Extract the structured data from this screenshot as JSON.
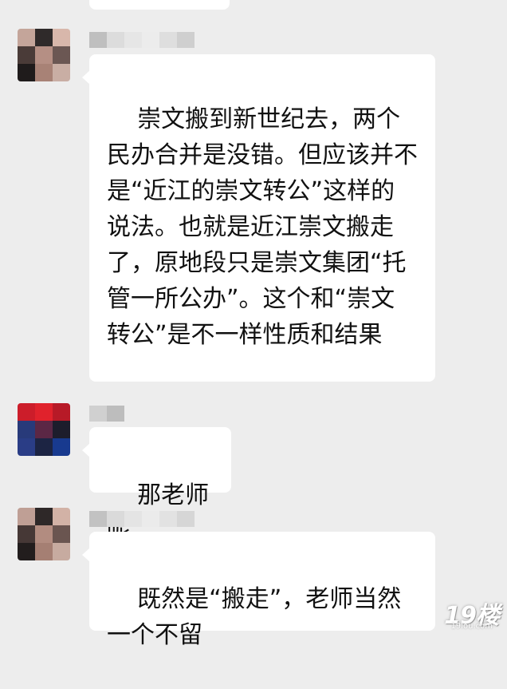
{
  "chat": {
    "background_color": "#ededed",
    "bubble_color": "#ffffff",
    "messages": [
      {
        "text": "崇文搬到新世纪去，两个民办合并是没错。但应该并不是“近江的崇文转公”这样的说法。也就是近江崇文搬走了，原地段只是崇文集团“托管一所公办”。这个和“崇文转公”是不一样性质和结果",
        "sender_name_obscured": true,
        "avatar_obscured": true
      },
      {
        "text": "那老师呢",
        "sender_name_obscured": true,
        "avatar_obscured": true
      },
      {
        "text": "既然是“搬走”，老师当然一个不留",
        "sender_name_obscured": true,
        "avatar_obscured": true
      }
    ]
  },
  "watermark": {
    "main": "19楼",
    "sub": "19lou.com"
  }
}
